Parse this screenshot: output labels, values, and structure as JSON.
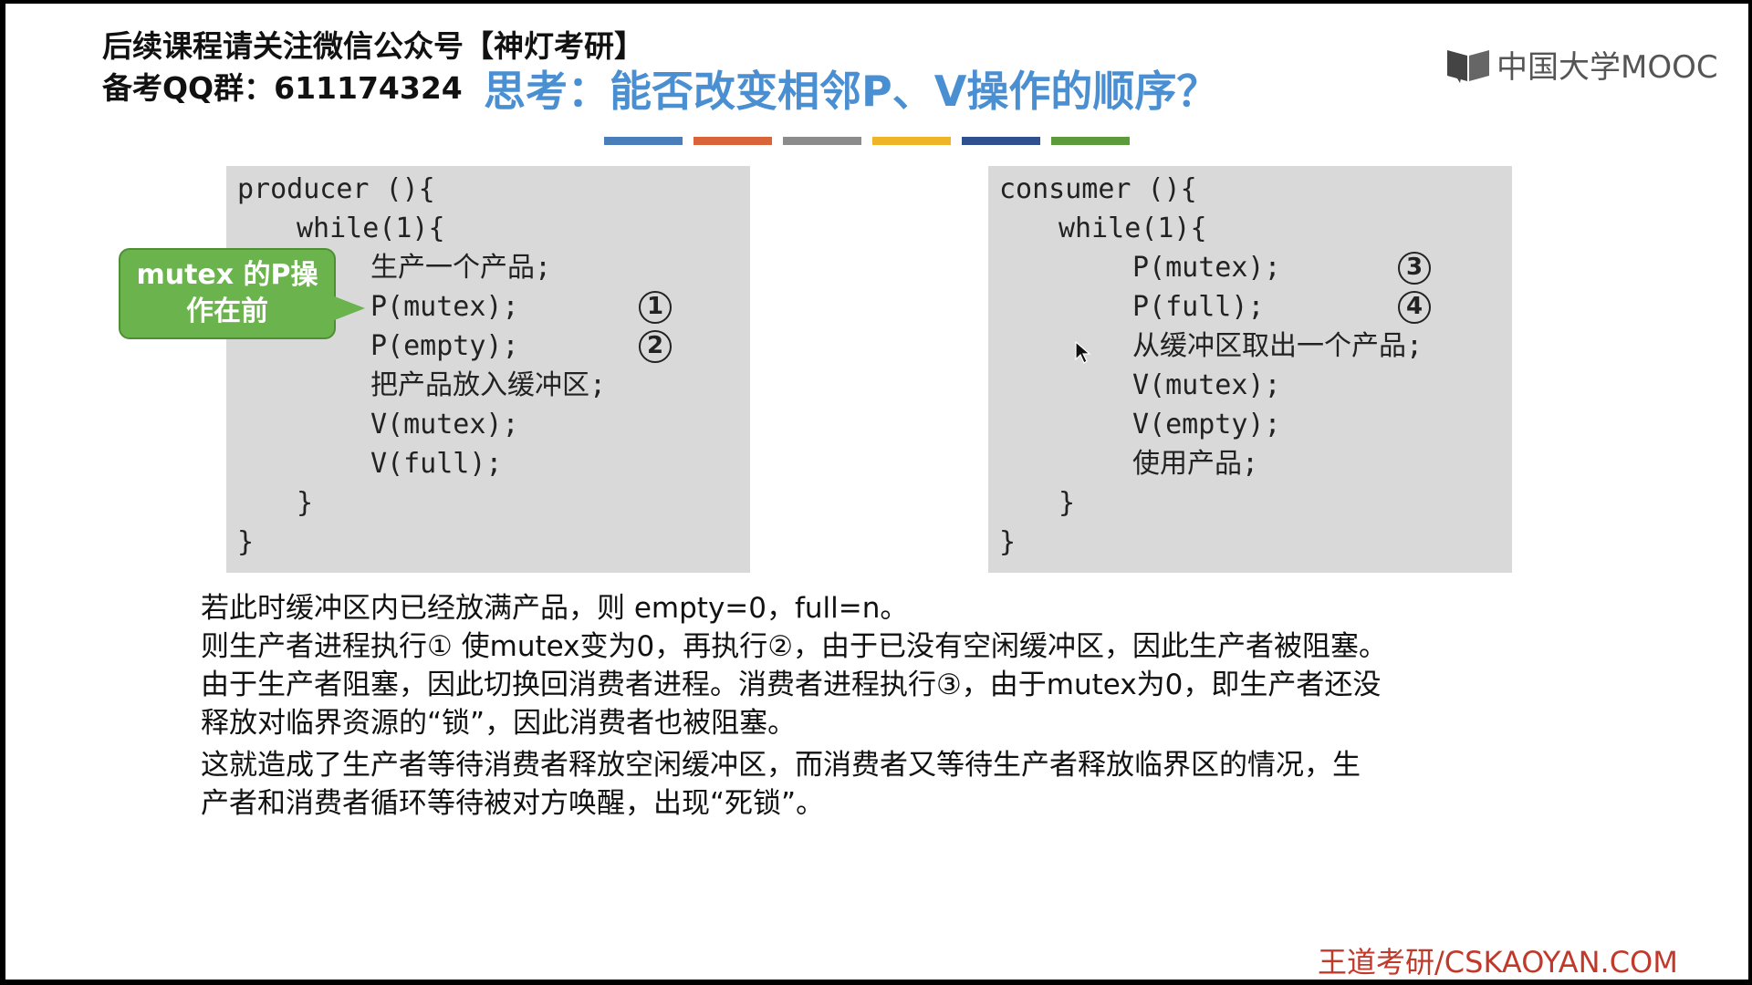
{
  "header": {
    "notice": "后续课程请关注微信公众号【神灯考研】",
    "qq_group": "备考QQ群：611174324"
  },
  "slide": {
    "title": "思考：能否改变相邻P、V操作的顺序？"
  },
  "logo": {
    "text": "中国大学MOOC"
  },
  "color_bar": [
    "#4a7ebb",
    "#d9643a",
    "#8c8c8c",
    "#f0b429",
    "#2f4f8f",
    "#5b9b3c"
  ],
  "callout": {
    "line1": "mutex 的P操",
    "line2": "作在前",
    "color": "#6bb34c"
  },
  "producer": {
    "lines": [
      "producer (){",
      "while(1){",
      "生产一个产品;",
      "P(mutex);",
      "P(empty);",
      "把产品放入缓冲区;",
      "V(mutex);",
      "V(full);",
      "}",
      "}"
    ],
    "markers": [
      "1",
      "2"
    ]
  },
  "consumer": {
    "lines": [
      "consumer (){",
      "while(1){",
      "P(mutex);",
      "P(full);",
      "从缓冲区取出一个产品;",
      "V(mutex);",
      "V(empty);",
      "使用产品;",
      "}",
      "}"
    ],
    "markers": [
      "3",
      "4"
    ]
  },
  "explanation": {
    "p1": "若此时缓冲区内已经放满产品，则 empty=0，full=n。",
    "p2": "则生产者进程执行① 使mutex变为0，再执行②，由于已没有空闲缓冲区，因此生产者被阻塞。",
    "p3a": "由于生产者阻塞，因此切换回消费者进程。消费者进程执行③，由于mutex为0，即生产者还没",
    "p3b": "释放对临界资源的“锁”，因此消费者也被阻塞。",
    "p4a": "这就造成了生产者等待消费者释放空闲缓冲区，而消费者又等待生产者释放临界区的情况，生",
    "p4b": "产者和消费者循环等待被对方唤醒，出现“死锁”。"
  },
  "footer": {
    "brand": "王道考研/CSKAOYAN.COM",
    "color": "#c0392b"
  }
}
